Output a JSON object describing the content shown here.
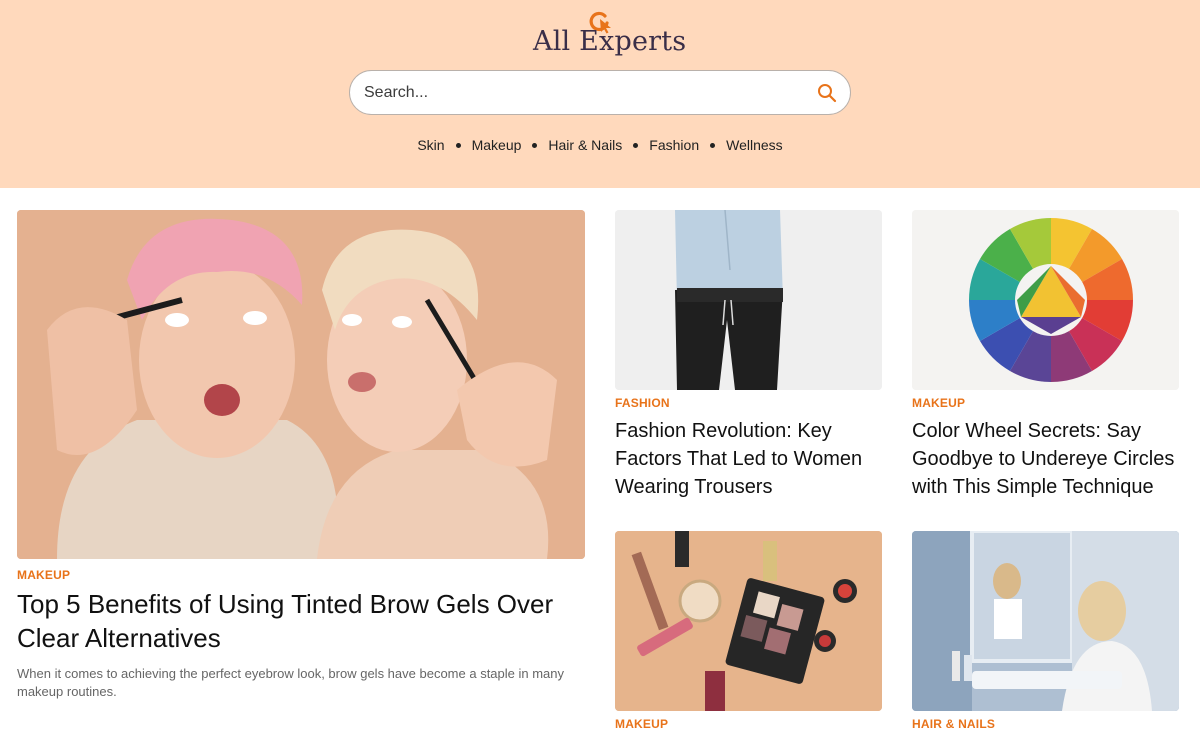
{
  "brand": {
    "name": "All Experts",
    "accent": "#e8731a",
    "header_bg": "#ffd9bc"
  },
  "search": {
    "placeholder": "Search...",
    "icon": "search-icon"
  },
  "nav": {
    "items": [
      {
        "label": "Skin"
      },
      {
        "label": "Makeup"
      },
      {
        "label": "Hair & Nails"
      },
      {
        "label": "Fashion"
      },
      {
        "label": "Wellness"
      }
    ]
  },
  "featured": {
    "category": "MAKEUP",
    "title": "Top 5 Benefits of Using Tinted Brow Gels Over Clear Alternatives",
    "excerpt": "When it comes to achieving the perfect eyebrow look, brow gels have become a staple in many makeup routines."
  },
  "cards": [
    {
      "category": "FASHION",
      "title": "Fashion Revolution: Key Factors That Led to Women Wearing Trousers"
    },
    {
      "category": "MAKEUP",
      "title": "Color Wheel Secrets: Say Goodbye to Undereye Circles with This Simple Technique"
    },
    {
      "category": "MAKEUP",
      "title": ""
    },
    {
      "category": "HAIR & NAILS",
      "title": ""
    }
  ]
}
